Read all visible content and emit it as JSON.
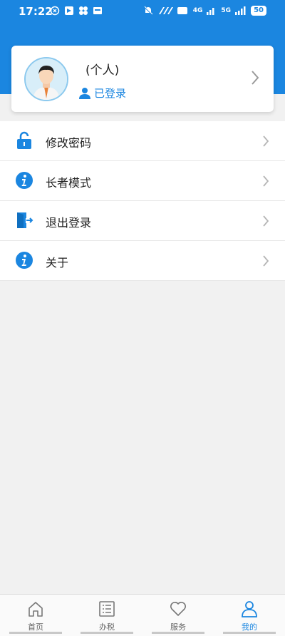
{
  "status_bar": {
    "time": "17:22",
    "network_label": "4G",
    "network_label_2": "5G",
    "battery": "50"
  },
  "profile": {
    "name": "(个人)",
    "login_status": "已登录"
  },
  "menu": [
    {
      "label": "修改密码",
      "icon": "lock-icon"
    },
    {
      "label": "长者模式",
      "icon": "info-icon"
    },
    {
      "label": "退出登录",
      "icon": "logout-door-icon"
    },
    {
      "label": "关于",
      "icon": "info-icon"
    }
  ],
  "tabs": [
    {
      "label": "首页",
      "icon": "home-icon"
    },
    {
      "label": "办税",
      "icon": "list-icon"
    },
    {
      "label": "服务",
      "icon": "heart-icon"
    },
    {
      "label": "我的",
      "icon": "user-icon",
      "active": true
    }
  ],
  "colors": {
    "primary": "#1b86e0",
    "background": "#f1f1f1"
  }
}
